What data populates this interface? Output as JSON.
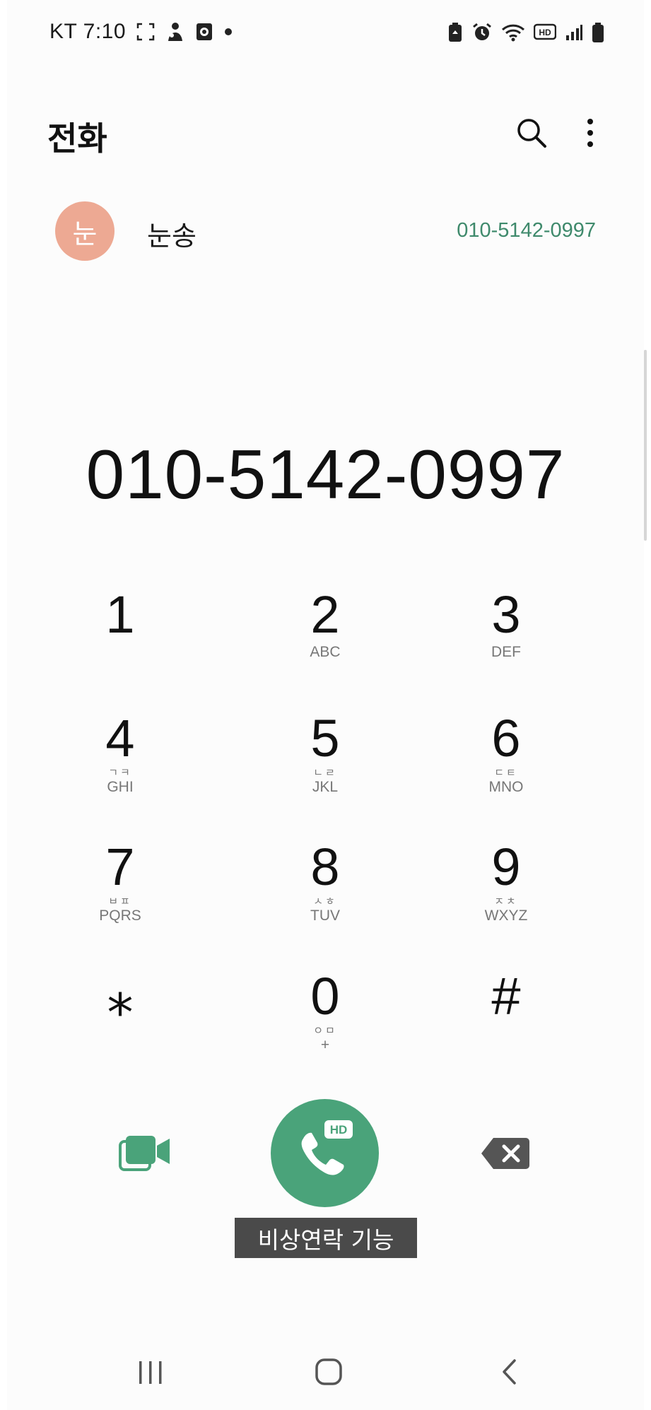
{
  "status_bar": {
    "carrier_time": "KT 7:10",
    "left_icons": [
      "screenshot-frame-icon",
      "app-notification-icon",
      "media-notification-icon",
      "dot-icon"
    ],
    "right_icons": [
      "battery-saver-icon",
      "alarm-icon",
      "wifi-icon",
      "hd-voice-icon",
      "signal-icon",
      "battery-icon"
    ],
    "hd_label": "HD"
  },
  "header": {
    "title": "전화",
    "search_icon": "search-icon",
    "more_icon": "more-vertical-icon"
  },
  "suggestion": {
    "avatar_initial": "눈",
    "avatar_color": "#eda993",
    "name": "눈송",
    "number": "010-5142-0997",
    "number_color": "#3f8a6c"
  },
  "dialed_number": "010-5142-0997",
  "keypad": [
    {
      "digit": "1",
      "hangul": "",
      "letters": ""
    },
    {
      "digit": "2",
      "hangul": "",
      "letters": "ABC"
    },
    {
      "digit": "3",
      "hangul": "",
      "letters": "DEF"
    },
    {
      "digit": "4",
      "hangul": "ㄱㅋ",
      "letters": "GHI"
    },
    {
      "digit": "5",
      "hangul": "ㄴㄹ",
      "letters": "JKL"
    },
    {
      "digit": "6",
      "hangul": "ㄷㅌ",
      "letters": "MNO"
    },
    {
      "digit": "7",
      "hangul": "ㅂㅍ",
      "letters": "PQRS"
    },
    {
      "digit": "8",
      "hangul": "ㅅㅎ",
      "letters": "TUV"
    },
    {
      "digit": "9",
      "hangul": "ㅈㅊ",
      "letters": "WXYZ"
    },
    {
      "digit": "⁎",
      "hangul": "",
      "letters": ""
    },
    {
      "digit": "0",
      "hangul": "ㅇㅁ",
      "letters": "+"
    },
    {
      "digit": "#",
      "hangul": "",
      "letters": ""
    }
  ],
  "actions": {
    "video_icon": "video-call-icon",
    "call_icon": "hd-voice-call-icon",
    "call_badge": "HD",
    "call_color": "#4aa37a",
    "backspace_icon": "backspace-icon"
  },
  "caption": "비상연락 기능",
  "nav": {
    "recents_icon": "recent-apps-icon",
    "home_icon": "home-icon",
    "back_icon": "back-icon"
  }
}
